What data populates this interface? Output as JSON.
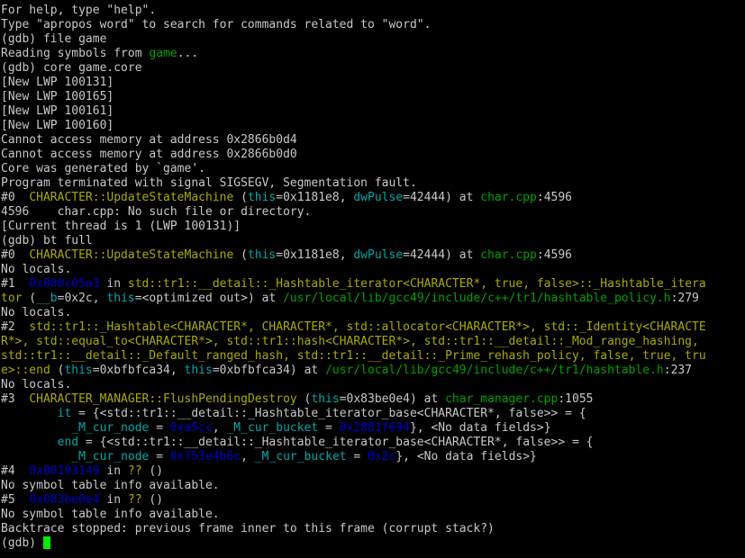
{
  "terminal": {
    "title": "gdb",
    "prompt": "(gdb)",
    "cursor": {
      "shape": "block",
      "color": "#00ee00",
      "visible": true
    },
    "colors": {
      "background": "#000000",
      "foreground": "#c8c8c8",
      "function": "#aaaa00",
      "filename": "#00a000",
      "variable": "#00a8a8",
      "address": "#0000cc",
      "cursor": "#00ee00"
    },
    "lines": [
      {
        "name": "help-hint-line",
        "spans": [
          {
            "text": "For help, type \"help\".",
            "color": "default"
          }
        ]
      },
      {
        "name": "apropos-hint-line",
        "spans": [
          {
            "text": "Type \"apropos word\" to search for commands related to \"word\".",
            "color": "default"
          }
        ]
      },
      {
        "name": "command-file-game",
        "spans": [
          {
            "text": "(gdb) file game",
            "color": "default"
          }
        ]
      },
      {
        "name": "reading-symbols-line",
        "spans": [
          {
            "text": "Reading symbols from ",
            "color": "default"
          },
          {
            "text": "game",
            "color": "green"
          },
          {
            "text": "...",
            "color": "default"
          }
        ]
      },
      {
        "name": "command-core-game-core",
        "spans": [
          {
            "text": "(gdb) core game.core",
            "color": "default"
          }
        ]
      },
      {
        "name": "new-lwp-100131",
        "spans": [
          {
            "text": "[New LWP 100131]",
            "color": "default"
          }
        ]
      },
      {
        "name": "new-lwp-100165",
        "spans": [
          {
            "text": "[New LWP 100165]",
            "color": "default"
          }
        ]
      },
      {
        "name": "new-lwp-100161",
        "spans": [
          {
            "text": "[New LWP 100161]",
            "color": "default"
          }
        ]
      },
      {
        "name": "new-lwp-100160",
        "spans": [
          {
            "text": "[New LWP 100160]",
            "color": "default"
          }
        ]
      },
      {
        "name": "cannot-access-memory-1",
        "spans": [
          {
            "text": "Cannot access memory at address 0x2866b0d4",
            "color": "default"
          }
        ]
      },
      {
        "name": "cannot-access-memory-2",
        "spans": [
          {
            "text": "Cannot access memory at address 0x2866b0d0",
            "color": "default"
          }
        ]
      },
      {
        "name": "core-generated-line",
        "spans": [
          {
            "text": "Core was generated by `game'.",
            "color": "default"
          }
        ]
      },
      {
        "name": "program-terminated-line",
        "spans": [
          {
            "text": "Program terminated with signal SIGSEGV, Segmentation fault.",
            "color": "default"
          }
        ]
      },
      {
        "name": "frame-0-header",
        "spans": [
          {
            "text": "#0  ",
            "color": "default"
          },
          {
            "text": "CHARACTER::UpdateStateMachine",
            "color": "yellow"
          },
          {
            "text": " (",
            "color": "default"
          },
          {
            "text": "this",
            "color": "cyan"
          },
          {
            "text": "=0x1181e8, ",
            "color": "default"
          },
          {
            "text": "dwPulse",
            "color": "cyan"
          },
          {
            "text": "=42444) at ",
            "color": "default"
          },
          {
            "text": "char.cpp",
            "color": "green"
          },
          {
            "text": ":4596",
            "color": "default"
          }
        ]
      },
      {
        "name": "source-unavailable-line",
        "spans": [
          {
            "text": "4596    char.cpp: No such file or directory.",
            "color": "default"
          }
        ]
      },
      {
        "name": "current-thread-line",
        "spans": [
          {
            "text": "[Current thread is 1 (LWP 100131)]",
            "color": "default"
          }
        ]
      },
      {
        "name": "command-bt-full",
        "spans": [
          {
            "text": "(gdb) bt full",
            "color": "default"
          }
        ]
      },
      {
        "name": "frame-0-backtrace",
        "spans": [
          {
            "text": "#0  ",
            "color": "default"
          },
          {
            "text": "CHARACTER::UpdateStateMachine",
            "color": "yellow"
          },
          {
            "text": " (",
            "color": "default"
          },
          {
            "text": "this",
            "color": "cyan"
          },
          {
            "text": "=0x1181e8, ",
            "color": "default"
          },
          {
            "text": "dwPulse",
            "color": "cyan"
          },
          {
            "text": "=42444) at ",
            "color": "default"
          },
          {
            "text": "char.cpp",
            "color": "green"
          },
          {
            "text": ":4596",
            "color": "default"
          }
        ]
      },
      {
        "name": "frame-0-no-locals",
        "spans": [
          {
            "text": "No locals.",
            "color": "default"
          }
        ]
      },
      {
        "name": "frame-1-header",
        "spans": [
          {
            "text": "#1  ",
            "color": "default"
          },
          {
            "text": "0x080c05a3",
            "color": "blue"
          },
          {
            "text": " in ",
            "color": "default"
          },
          {
            "text": "std::tr1::__detail::_Hashtable_iterator<CHARACTER*, true, false>::_Hashtable_itera",
            "color": "yellow"
          }
        ]
      },
      {
        "name": "frame-1-continued",
        "spans": [
          {
            "text": "tor",
            "color": "yellow"
          },
          {
            "text": " (",
            "color": "default"
          },
          {
            "text": "__b",
            "color": "cyan"
          },
          {
            "text": "=0x2c, ",
            "color": "default"
          },
          {
            "text": "this",
            "color": "cyan"
          },
          {
            "text": "=<optimized out>) at ",
            "color": "default"
          },
          {
            "text": "/usr/local/lib/gcc49/include/c++/tr1/hashtable_policy.h",
            "color": "green"
          },
          {
            "text": ":279",
            "color": "default"
          }
        ]
      },
      {
        "name": "frame-1-no-locals",
        "spans": [
          {
            "text": "No locals.",
            "color": "default"
          }
        ]
      },
      {
        "name": "frame-2-header",
        "spans": [
          {
            "text": "#2  ",
            "color": "default"
          },
          {
            "text": "std::tr1::_Hashtable<CHARACTER*, CHARACTER*, std::allocator<CHARACTER*>, std::_Identity<CHARACTE",
            "color": "yellow"
          }
        ]
      },
      {
        "name": "frame-2-continued-1",
        "spans": [
          {
            "text": "R*>, std::equal_to<CHARACTER*>, std::tr1::hash<CHARACTER*>, std::tr1::__detail::_Mod_range_hashing,",
            "color": "yellow"
          }
        ]
      },
      {
        "name": "frame-2-continued-2",
        "spans": [
          {
            "text": "std::tr1::__detail::_Default_ranged_hash, std::tr1::__detail::_Prime_rehash_policy, false, true, tru",
            "color": "yellow"
          }
        ]
      },
      {
        "name": "frame-2-continued-3",
        "spans": [
          {
            "text": "e>::end",
            "color": "yellow"
          },
          {
            "text": " (",
            "color": "default"
          },
          {
            "text": "this",
            "color": "cyan"
          },
          {
            "text": "=0xbfbfca34, ",
            "color": "default"
          },
          {
            "text": "this",
            "color": "cyan"
          },
          {
            "text": "=0xbfbfca34) at ",
            "color": "default"
          },
          {
            "text": "/usr/local/lib/gcc49/include/c++/tr1/hashtable.h",
            "color": "green"
          },
          {
            "text": ":237",
            "color": "default"
          }
        ]
      },
      {
        "name": "frame-2-no-locals",
        "spans": [
          {
            "text": "No locals.",
            "color": "default"
          }
        ]
      },
      {
        "name": "frame-3-header",
        "spans": [
          {
            "text": "#3  ",
            "color": "default"
          },
          {
            "text": "CHARACTER_MANAGER::FlushPendingDestroy",
            "color": "yellow"
          },
          {
            "text": " (",
            "color": "default"
          },
          {
            "text": "this",
            "color": "cyan"
          },
          {
            "text": "=0x83be0e4) at ",
            "color": "default"
          },
          {
            "text": "char_manager.cpp",
            "color": "green"
          },
          {
            "text": ":1055",
            "color": "default"
          }
        ]
      },
      {
        "name": "frame-3-local-it",
        "spans": [
          {
            "text": "        ",
            "color": "default"
          },
          {
            "text": "it",
            "color": "cyan"
          },
          {
            "text": " = {<std::tr1::__detail::_Hashtable_iterator_base<CHARACTER*, false>> = {",
            "color": "default"
          }
        ]
      },
      {
        "name": "frame-3-local-it-fields",
        "spans": [
          {
            "text": "          ",
            "color": "default"
          },
          {
            "text": "_M_cur_node",
            "color": "cyan"
          },
          {
            "text": " = ",
            "color": "default"
          },
          {
            "text": "0xa5cc",
            "color": "blue"
          },
          {
            "text": ", ",
            "color": "default"
          },
          {
            "text": "_M_cur_bucket",
            "color": "cyan"
          },
          {
            "text": " = ",
            "color": "default"
          },
          {
            "text": "0x2881f694",
            "color": "blue"
          },
          {
            "text": "}, <No data fields>}",
            "color": "default"
          }
        ]
      },
      {
        "name": "frame-3-local-end",
        "spans": [
          {
            "text": "        ",
            "color": "default"
          },
          {
            "text": "end",
            "color": "cyan"
          },
          {
            "text": " = {<std::tr1::__detail::_Hashtable_iterator_base<CHARACTER*, false>> = {",
            "color": "default"
          }
        ]
      },
      {
        "name": "frame-3-local-end-fields",
        "spans": [
          {
            "text": "          ",
            "color": "default"
          },
          {
            "text": "_M_cur_node",
            "color": "cyan"
          },
          {
            "text": " = ",
            "color": "default"
          },
          {
            "text": "0x753e4b6c",
            "color": "blue"
          },
          {
            "text": ", ",
            "color": "default"
          },
          {
            "text": "_M_cur_bucket",
            "color": "cyan"
          },
          {
            "text": " = ",
            "color": "default"
          },
          {
            "text": "0x2c",
            "color": "blue"
          },
          {
            "text": "}, <No data fields>}",
            "color": "default"
          }
        ]
      },
      {
        "name": "frame-4-header",
        "spans": [
          {
            "text": "#4  ",
            "color": "default"
          },
          {
            "text": "0x00193149",
            "color": "blue"
          },
          {
            "text": " in ",
            "color": "default"
          },
          {
            "text": "??",
            "color": "yellow"
          },
          {
            "text": " ()",
            "color": "default"
          }
        ]
      },
      {
        "name": "frame-4-no-symbols",
        "spans": [
          {
            "text": "No symbol table info available.",
            "color": "default"
          }
        ]
      },
      {
        "name": "frame-5-header",
        "spans": [
          {
            "text": "#5  ",
            "color": "default"
          },
          {
            "text": "0x083be0e4",
            "color": "blue"
          },
          {
            "text": " in ",
            "color": "default"
          },
          {
            "text": "??",
            "color": "yellow"
          },
          {
            "text": " ()",
            "color": "default"
          }
        ]
      },
      {
        "name": "frame-5-no-symbols",
        "spans": [
          {
            "text": "No symbol table info available.",
            "color": "default"
          }
        ]
      },
      {
        "name": "backtrace-stopped-line",
        "spans": [
          {
            "text": "Backtrace stopped: previous frame inner to this frame (corrupt stack?)",
            "color": "default"
          }
        ]
      },
      {
        "name": "prompt-line",
        "spans": [
          {
            "text": "(gdb) ",
            "color": "default"
          }
        ],
        "cursor": true
      }
    ]
  }
}
